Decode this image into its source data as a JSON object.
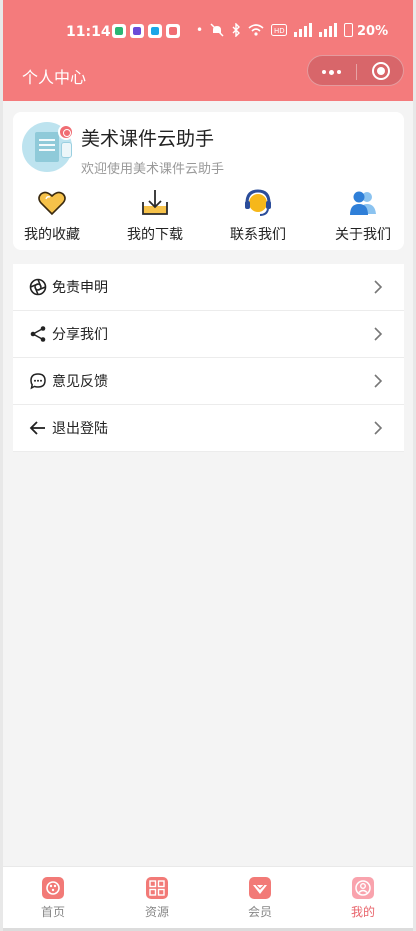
{
  "status_bar": {
    "time": "11:14",
    "battery": "20%"
  },
  "header": {
    "title": "个人中心",
    "capsule_icons": [
      "more-dots-icon",
      "close-target-icon"
    ]
  },
  "profile": {
    "name": "美术课件云助手",
    "welcome": "欢迎使用美术课件云助手",
    "gender_icon": "male-icon"
  },
  "quick_actions": [
    {
      "label": "我的收藏",
      "icon": "heart-icon"
    },
    {
      "label": "我的下载",
      "icon": "download-icon"
    },
    {
      "label": "联系我们",
      "icon": "headset-icon"
    },
    {
      "label": "关于我们",
      "icon": "people-icon"
    }
  ],
  "menu": [
    {
      "label": "免责申明",
      "icon": "aperture-icon"
    },
    {
      "label": "分享我们",
      "icon": "share-icon"
    },
    {
      "label": "意见反馈",
      "icon": "chat-bubble-icon"
    },
    {
      "label": "退出登陆",
      "icon": "arrow-left-icon"
    }
  ],
  "tabbar": {
    "items": [
      {
        "label": "首页",
        "icon": "home-icon"
      },
      {
        "label": "资源",
        "icon": "grid-icon"
      },
      {
        "label": "会员",
        "icon": "member-icon"
      },
      {
        "label": "我的",
        "icon": "user-icon"
      }
    ],
    "active": "我的"
  },
  "colors": {
    "header": "#f47b7c",
    "accent": "#e8646b",
    "background": "#f4f4f4"
  }
}
